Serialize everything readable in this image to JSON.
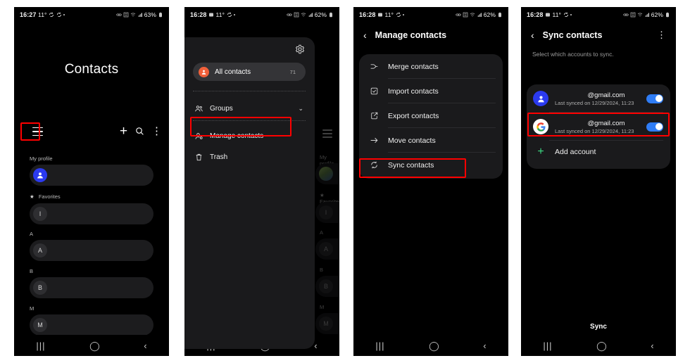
{
  "panels": [
    {
      "id": "contacts-list",
      "status": {
        "time": "16:27",
        "temp": "11°",
        "battery": "63%"
      },
      "title": "Contacts",
      "actions": {
        "menu": "hamburger-icon",
        "add": "plus-icon",
        "search": "search-icon",
        "more": "more-options-icon"
      },
      "sections": [
        {
          "label": "My profile",
          "rows": [
            {
              "avatar": "profile-photo",
              "letter": ""
            }
          ]
        },
        {
          "label": "Favorites",
          "star": true,
          "rows": [
            {
              "avatar": "letter",
              "letter": "I"
            }
          ]
        },
        {
          "label": "A",
          "rows": [
            {
              "avatar": "letter",
              "letter": "A"
            }
          ]
        },
        {
          "label": "B",
          "rows": [
            {
              "avatar": "letter",
              "letter": "B"
            }
          ]
        },
        {
          "label": "M",
          "rows": [
            {
              "avatar": "letter",
              "letter": "M"
            }
          ]
        }
      ]
    },
    {
      "id": "navigation-drawer",
      "status": {
        "time": "16:28",
        "temp": "11°",
        "battery": "62%"
      },
      "settings_icon": "gear-icon",
      "all_contacts": {
        "label": "All contacts",
        "count": "71"
      },
      "items": [
        {
          "label": "Groups",
          "icon": "group-icon",
          "chevron": "chevron-down-icon"
        },
        {
          "label": "Manage contacts",
          "icon": "manage-contacts-icon",
          "highlighted": true
        },
        {
          "label": "Trash",
          "icon": "trash-icon"
        }
      ]
    },
    {
      "id": "manage-contacts",
      "status": {
        "time": "16:28",
        "temp": "11°",
        "battery": "62%"
      },
      "appbar": {
        "back": "back-arrow-icon",
        "title": "Manage contacts"
      },
      "items": [
        {
          "label": "Merge contacts",
          "icon": "merge-icon"
        },
        {
          "label": "Import contacts",
          "icon": "import-icon"
        },
        {
          "label": "Export contacts",
          "icon": "export-icon"
        },
        {
          "label": "Move contacts",
          "icon": "arrow-right-icon"
        },
        {
          "label": "Sync contacts",
          "icon": "sync-icon",
          "highlighted": true
        }
      ]
    },
    {
      "id": "sync-contacts",
      "status": {
        "time": "16:28",
        "temp": "11°",
        "battery": "62%"
      },
      "appbar": {
        "back": "back-arrow-icon",
        "title": "Sync contacts",
        "kebab": "more-options-icon"
      },
      "subtitle": "Select which accounts to sync.",
      "accounts": [
        {
          "email": "@gmail.com",
          "sub": "Last synced on 12/29/2024, 11:23",
          "avatar": "samsung-account-icon",
          "toggle": "on"
        },
        {
          "email": "@gmail.com",
          "sub": "Last synced on 12/29/2024, 11:23",
          "avatar": "google-icon",
          "toggle": "on",
          "highlighted": true
        }
      ],
      "add_account": {
        "label": "Add account",
        "icon": "plus-icon"
      },
      "sync_button": "Sync"
    }
  ],
  "navbar": {
    "recents": "|||",
    "home": "◯",
    "back": "‹"
  },
  "colors": {
    "accent_blue": "#2b3aef",
    "toggle_blue": "#2f7df6",
    "orange": "#f0603a",
    "green": "#3ddc84",
    "highlight": "#ff0000"
  }
}
